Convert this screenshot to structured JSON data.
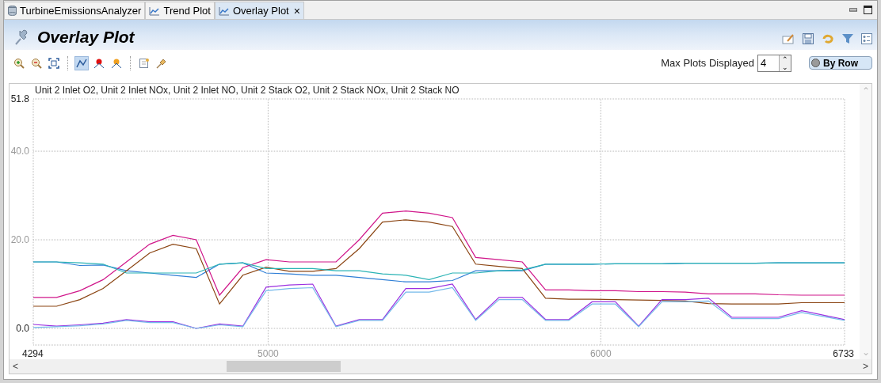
{
  "tabs": [
    {
      "label": "TurbineEmissionsAnalyzer",
      "kind": "database",
      "selected": false,
      "closable": false
    },
    {
      "label": "Trend Plot",
      "kind": "chart",
      "selected": false,
      "closable": false
    },
    {
      "label": "Overlay Plot",
      "kind": "chart",
      "selected": true,
      "closable": true
    }
  ],
  "close_glyph": "×",
  "header": {
    "title": "Overlay Plot"
  },
  "toolbar": [
    {
      "kind": "zoom-in",
      "selected": false
    },
    {
      "kind": "zoom-out",
      "selected": false
    },
    {
      "kind": "fit",
      "selected": false
    },
    {
      "kind": "sep"
    },
    {
      "kind": "lines",
      "selected": true
    },
    {
      "kind": "red-marker",
      "selected": false
    },
    {
      "kind": "orange-marker",
      "selected": false
    },
    {
      "kind": "sep"
    },
    {
      "kind": "note",
      "selected": false
    },
    {
      "kind": "pin",
      "selected": false
    }
  ],
  "max_plots": {
    "label": "Max Plots Displayed",
    "value": "4"
  },
  "by_row": {
    "label": "By Row",
    "on": false
  },
  "plot": {
    "chart_data": {
      "type": "line",
      "grid": true,
      "title": "Unit 2 Inlet O2, Unit 2 Inlet NOx, Unit 2 Inlet NO, Unit 2 Stack O2, Unit 2 Stack NOx, Unit 2 Stack NO",
      "x": [
        4294,
        4364,
        4434,
        4504,
        4574,
        4644,
        4714,
        4784,
        4854,
        4924,
        4994,
        5064,
        5134,
        5204,
        5274,
        5344,
        5414,
        5484,
        5554,
        5624,
        5694,
        5764,
        5834,
        5904,
        5974,
        6044,
        6114,
        6184,
        6254,
        6324,
        6394,
        6464,
        6534,
        6604,
        6733
      ],
      "xlim": [
        4294,
        6733
      ],
      "ylim": [
        -3.75,
        51.8
      ],
      "xticks": [
        4294,
        5000,
        6000,
        6733
      ],
      "yticks": [
        {
          "value": 0,
          "label": "0.0"
        },
        {
          "value": 20,
          "label": "20.0"
        },
        {
          "value": 40,
          "label": "40.0"
        },
        {
          "value": 51.8,
          "label": "51.8"
        }
      ],
      "series": [
        {
          "color": "#2f7fd6",
          "values": [
            15,
            15,
            14.2,
            14.3,
            13,
            12.5,
            12,
            11.5,
            14.5,
            14.8,
            12.5,
            12.3,
            12,
            12,
            11.5,
            11,
            10.5,
            10.5,
            10.8,
            13,
            13,
            13,
            14.5,
            14.5,
            14.5,
            14.6,
            14.6,
            14.6,
            14.7,
            14.7,
            14.7,
            14.7,
            14.8,
            14.8,
            14.8
          ]
        },
        {
          "color": "#d0168a",
          "values": [
            7,
            7,
            8.5,
            11,
            15,
            19,
            21,
            20,
            7.5,
            13.7,
            15.5,
            15,
            15,
            15,
            20,
            26,
            26.5,
            26,
            25,
            16,
            15.5,
            15,
            8.7,
            8.7,
            8.5,
            8.5,
            8.3,
            8.3,
            8.2,
            7.8,
            7.8,
            7.8,
            7.6,
            7.5,
            7.5
          ]
        },
        {
          "color": "#8b4513",
          "values": [
            5,
            5,
            6.5,
            9,
            13,
            17,
            19,
            18,
            5.5,
            12,
            13.8,
            12.9,
            12.9,
            13.5,
            18,
            24,
            24.5,
            24,
            23,
            14.5,
            14,
            13.5,
            6.8,
            6.6,
            6.6,
            6.5,
            6.4,
            6.3,
            6.2,
            5.6,
            5.5,
            5.5,
            5.5,
            5.8,
            5.8
          ]
        },
        {
          "color": "#2ab3b5",
          "values": [
            15,
            15,
            14.8,
            14.5,
            12.5,
            12.5,
            12.5,
            12.5,
            14.5,
            14.8,
            13.5,
            13.5,
            13.5,
            13,
            13,
            12.3,
            12,
            11,
            12.5,
            12.5,
            13,
            13.2,
            14.5,
            14.5,
            14.5,
            14.6,
            14.6,
            14.6,
            14.7,
            14.7,
            14.7,
            14.7,
            14.8,
            14.8,
            14.8
          ]
        },
        {
          "color": "#9b30e0",
          "values": [
            0.9,
            0.5,
            0.8,
            1.2,
            2,
            1.5,
            1.5,
            0,
            1,
            0.5,
            9.3,
            9.8,
            10,
            0.5,
            2,
            2,
            9,
            9,
            10,
            2,
            7,
            7,
            2,
            2,
            6,
            6,
            0.5,
            6.5,
            6.5,
            6.8,
            2.5,
            2.5,
            2.5,
            4,
            2
          ]
        },
        {
          "color": "#74b9ea",
          "values": [
            0.2,
            0.4,
            0.6,
            1,
            1.8,
            1.3,
            1.3,
            0,
            0.8,
            0.4,
            8.5,
            9,
            9.2,
            0.4,
            1.8,
            1.8,
            8.2,
            8.2,
            9.2,
            1.8,
            6.5,
            6.5,
            1.8,
            1.8,
            5.5,
            5.5,
            0.4,
            6,
            6,
            6.2,
            2.2,
            2.2,
            2.2,
            3.6,
            1.8
          ]
        }
      ]
    }
  },
  "arrows": {
    "up": "⌃",
    "down": "⌄",
    "left": "<",
    "right": ">"
  }
}
